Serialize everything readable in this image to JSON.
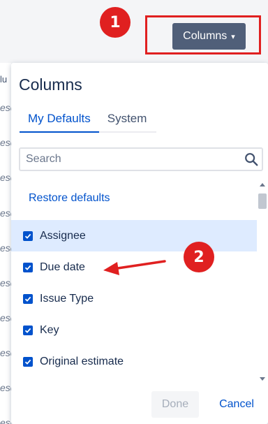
{
  "toolbar": {
    "columns_label": "Columns",
    "chevron_glyph": "⌄"
  },
  "background": {
    "header_fragment": "lu",
    "cell_fragments": [
      "esc",
      "esc",
      "esc",
      "esc",
      "esc",
      "esc",
      "esc",
      "esc",
      "esc",
      "esc",
      "esc"
    ]
  },
  "annotations": {
    "badge1": "1",
    "badge2": "2",
    "accent": "#e02020"
  },
  "popover": {
    "title": "Columns",
    "tabs": [
      {
        "label": "My Defaults",
        "active": true
      },
      {
        "label": "System",
        "active": false
      }
    ],
    "search": {
      "placeholder": "Search",
      "value": ""
    },
    "restore_label": "Restore defaults",
    "items": [
      {
        "label": "Assignee",
        "checked": true,
        "highlighted": true
      },
      {
        "label": "Due date",
        "checked": true,
        "highlighted": false
      },
      {
        "label": "Issue Type",
        "checked": true,
        "highlighted": false
      },
      {
        "label": "Key",
        "checked": true,
        "highlighted": false
      },
      {
        "label": "Original estimate",
        "checked": true,
        "highlighted": false
      }
    ],
    "done_label": "Done",
    "cancel_label": "Cancel"
  },
  "colors": {
    "primary": "#0052cc",
    "button_dark": "#505f79",
    "highlight": "#deebff"
  }
}
